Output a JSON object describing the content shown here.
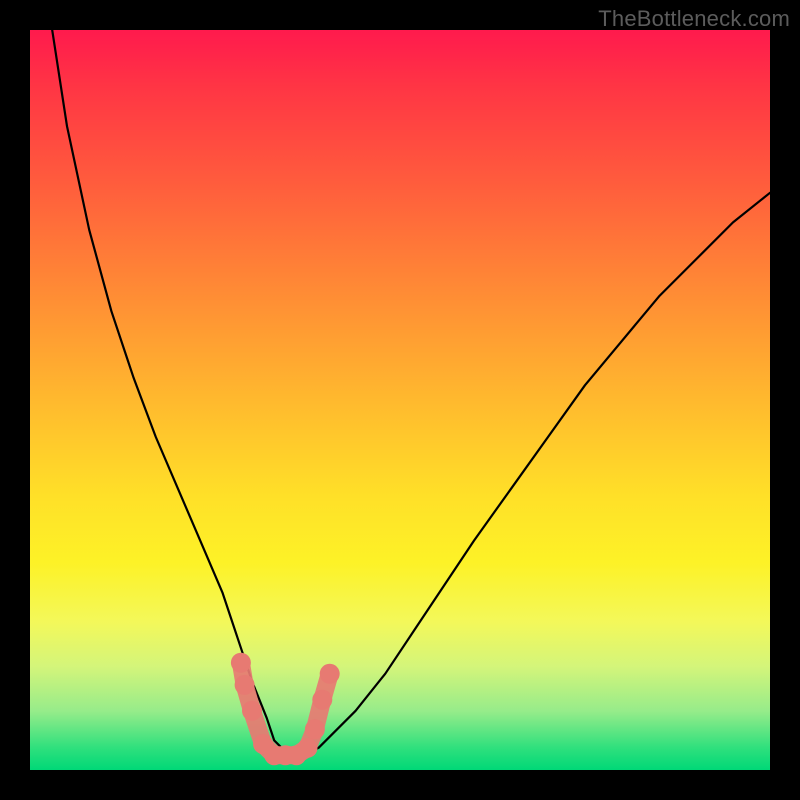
{
  "watermark": "TheBottleneck.com",
  "colors": {
    "frame": "#000000",
    "curve_stroke": "#000000",
    "marker_fill": "#e77a72",
    "marker_stroke": "#c9635b",
    "gradient_stops": [
      "#ff1a4d",
      "#ff5a3d",
      "#ffb92e",
      "#fdf227",
      "#2fe07d"
    ]
  },
  "chart_data": {
    "type": "line",
    "title": "",
    "xlabel": "",
    "ylabel": "",
    "xlim": [
      0,
      100
    ],
    "ylim": [
      0,
      100
    ],
    "note": "V-shaped bottleneck curve. Y axis points upward (0 at bottom, 100 at top). Values below are (x, y) estimates read from the plot.",
    "series": [
      {
        "name": "curve",
        "x": [
          3,
          5,
          8,
          11,
          14,
          17,
          20,
          23,
          26,
          28,
          30,
          32,
          33,
          35,
          37,
          39,
          44,
          48,
          52,
          56,
          60,
          65,
          70,
          75,
          80,
          85,
          90,
          95,
          100
        ],
        "y": [
          100,
          87,
          73,
          62,
          53,
          45,
          38,
          31,
          24,
          18,
          12,
          7,
          4,
          2,
          2,
          3,
          8,
          13,
          19,
          25,
          31,
          38,
          45,
          52,
          58,
          64,
          69,
          74,
          78
        ]
      },
      {
        "name": "markers",
        "x": [
          28.5,
          29.0,
          30.0,
          31.5,
          33.0,
          34.5,
          36.0,
          37.5,
          38.5,
          39.5,
          40.5
        ],
        "y": [
          14.5,
          11.5,
          8.0,
          3.5,
          2.0,
          2.0,
          2.0,
          3.0,
          5.5,
          9.5,
          13.0
        ]
      }
    ]
  }
}
